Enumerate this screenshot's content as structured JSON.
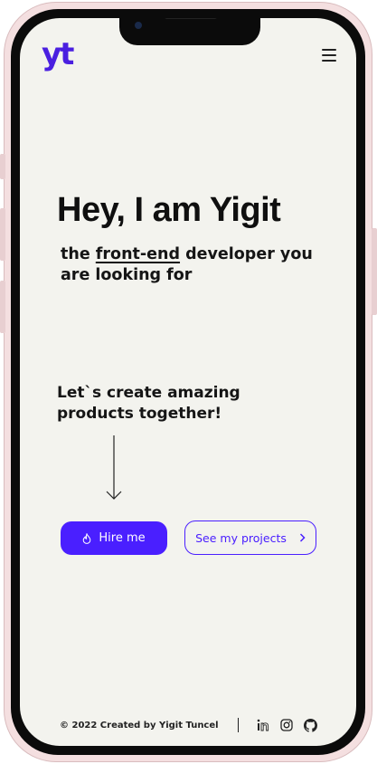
{
  "brand": {
    "logo_text": "yt",
    "accent_color": "#4a1fff"
  },
  "header": {
    "menu_icon": "hamburger-menu-icon"
  },
  "hero": {
    "title": "Hey, I am Yigit",
    "subtitle_prefix": "the ",
    "subtitle_highlight": "front-end",
    "subtitle_suffix": " developer you are looking for"
  },
  "cta": {
    "tagline": "Let`s create amazing products together!",
    "hire_label": "Hire me",
    "hire_icon": "flame-icon",
    "projects_label": "See my projects",
    "projects_icon": "chevron-right-icon"
  },
  "footer": {
    "copyright": "© 2022 Created by Yigit Tuncel",
    "social": [
      "linkedin-icon",
      "instagram-icon",
      "github-icon"
    ]
  }
}
